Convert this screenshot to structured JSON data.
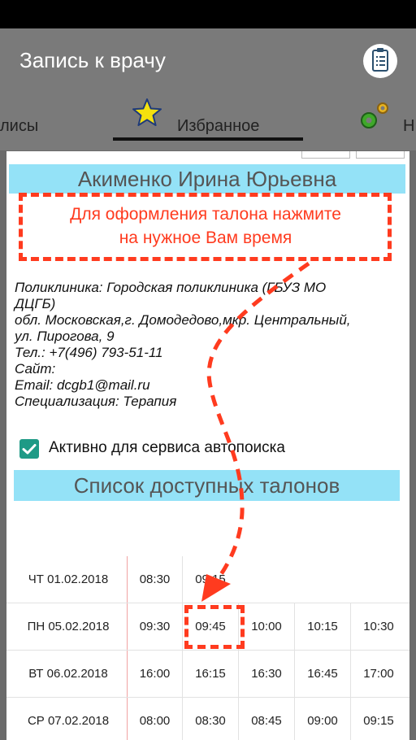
{
  "app": {
    "title": "Запись к врачу"
  },
  "tabs": [
    {
      "label": "лисы"
    },
    {
      "label": "Избранное",
      "icon": "star-icon"
    },
    {
      "label": "Н",
      "icon": "gears-icon"
    }
  ],
  "doctor": {
    "name": "Акименко Ирина Юрьевна",
    "hint": [
      "Для оформления талона нажмите",
      "на нужное Вам время"
    ],
    "info_lines": [
      "Поликлиника: Городская поликлиника (ГБУЗ МО",
      "ДЦГБ)",
      "обл. Московская,г. Домодедово,мкр. Центральный,",
      "ул. Пирогова, 9",
      "Тел.: +7(496) 793-51-11",
      "Сайт:",
      "Email: dcgb1@mail.ru",
      "Специализация: Терапия"
    ],
    "autosearch_label": "Активно для сервиса автопоиска",
    "autosearch_checked": true
  },
  "list_title": "Список доступных талонов",
  "schedule": [
    {
      "date": "ЧТ 01.02.2018",
      "times": [
        "08:30",
        "09:15"
      ]
    },
    {
      "date": "ПН 05.02.2018",
      "times": [
        "09:30",
        "09:45",
        "10:00",
        "10:15",
        "10:30"
      ]
    },
    {
      "date": "ВТ 06.02.2018",
      "times": [
        "16:00",
        "16:15",
        "16:30",
        "16:45",
        "17:00"
      ]
    },
    {
      "date": "СР 07.02.2018",
      "times": [
        "08:00",
        "08:30",
        "08:45",
        "09:00",
        "09:15"
      ]
    }
  ],
  "colors": {
    "annotation": "#ff3b1f",
    "accent": "#94e2f7",
    "checkbox": "#1e9a86"
  }
}
